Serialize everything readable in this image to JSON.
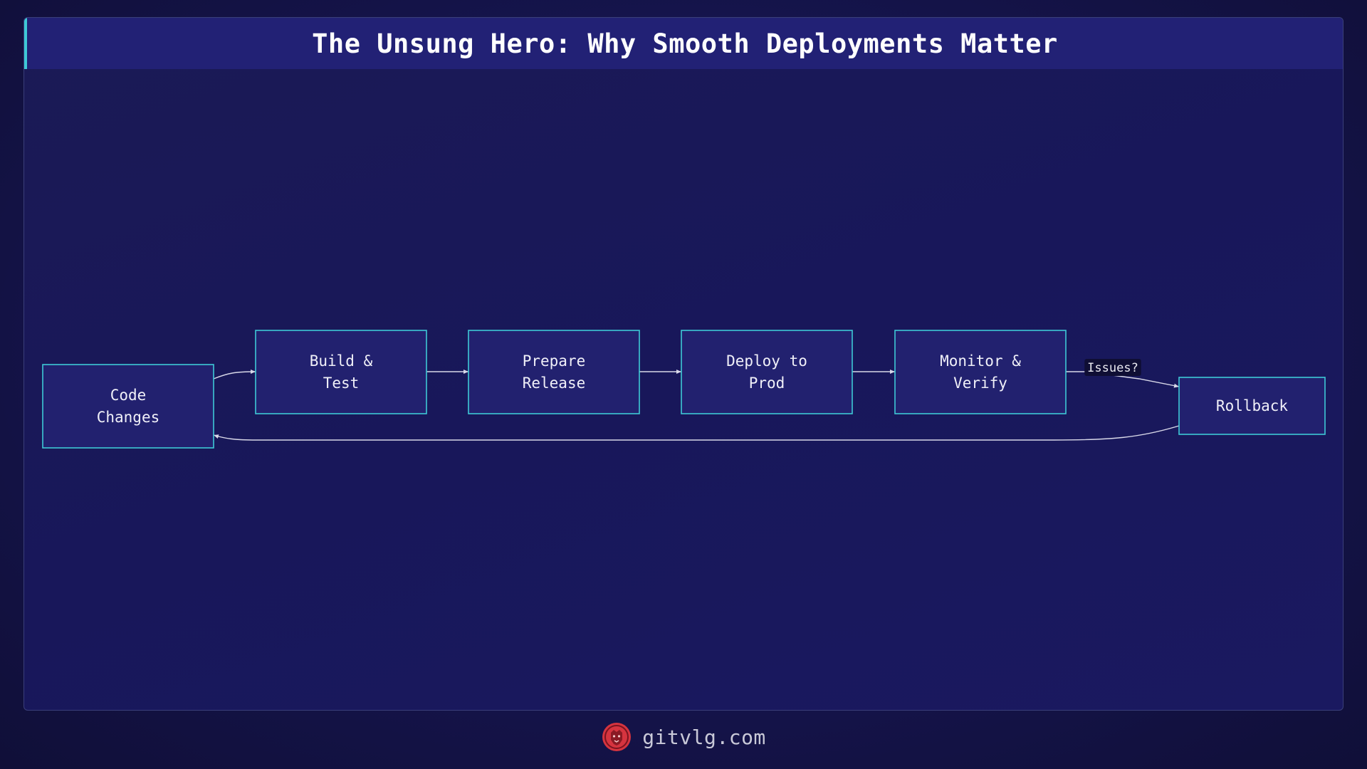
{
  "title": "The Unsung Hero: Why Smooth Deployments Matter",
  "nodes": [
    {
      "id": "code",
      "lines": [
        "Code",
        "Changes"
      ]
    },
    {
      "id": "build",
      "lines": [
        "Build &",
        "Test"
      ]
    },
    {
      "id": "prepare",
      "lines": [
        "Prepare",
        "Release"
      ]
    },
    {
      "id": "deploy",
      "lines": [
        "Deploy to",
        "Prod"
      ]
    },
    {
      "id": "monitor",
      "lines": [
        "Monitor &",
        "Verify"
      ]
    },
    {
      "id": "rollback",
      "lines": [
        "Rollback"
      ]
    }
  ],
  "edges": [
    {
      "from": "code",
      "to": "build",
      "label": ""
    },
    {
      "from": "build",
      "to": "prepare",
      "label": ""
    },
    {
      "from": "prepare",
      "to": "deploy",
      "label": ""
    },
    {
      "from": "deploy",
      "to": "monitor",
      "label": ""
    },
    {
      "from": "monitor",
      "to": "rollback",
      "label": "Issues?"
    },
    {
      "from": "rollback",
      "to": "code",
      "label": ""
    }
  ],
  "footer": {
    "brand": "gitvlg.com",
    "logo_icon": "lion-head-icon"
  },
  "colors": {
    "node_fill": "#22216f",
    "node_border": "#3ec9d6",
    "header_bg": "#222175",
    "accent": "#3ec9d6",
    "logo_red": "#d6343f"
  }
}
